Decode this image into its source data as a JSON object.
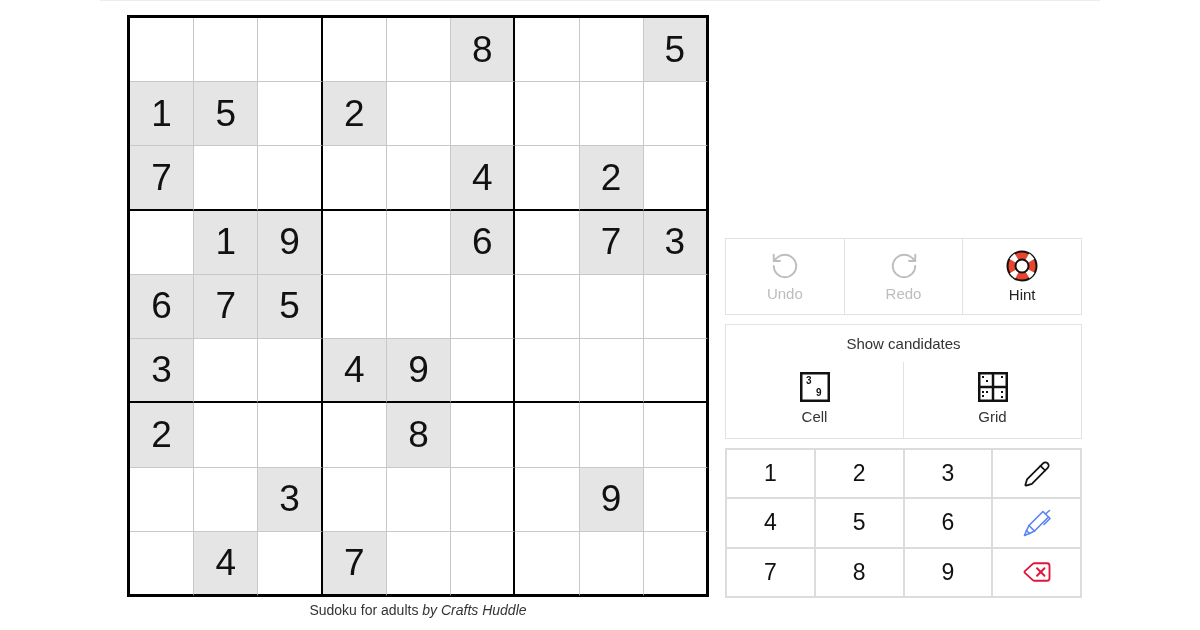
{
  "puzzle": {
    "rows": [
      [
        {
          "given": false
        },
        {
          "given": false
        },
        {
          "given": false
        },
        {
          "given": false
        },
        {
          "given": false
        },
        {
          "given": true,
          "value": "8"
        },
        {
          "given": false
        },
        {
          "given": false
        },
        {
          "given": true,
          "value": "5"
        }
      ],
      [
        {
          "given": true,
          "value": "1"
        },
        {
          "given": true,
          "value": "5"
        },
        {
          "given": false
        },
        {
          "given": true,
          "value": "2"
        },
        {
          "given": false
        },
        {
          "given": false
        },
        {
          "given": false
        },
        {
          "given": false
        },
        {
          "given": false
        }
      ],
      [
        {
          "given": true,
          "value": "7"
        },
        {
          "given": false
        },
        {
          "given": false
        },
        {
          "given": false
        },
        {
          "given": false
        },
        {
          "given": true,
          "value": "4"
        },
        {
          "given": false
        },
        {
          "given": true,
          "value": "2"
        },
        {
          "given": false
        }
      ],
      [
        {
          "given": false
        },
        {
          "given": true,
          "value": "1"
        },
        {
          "given": true,
          "value": "9"
        },
        {
          "given": false
        },
        {
          "given": false
        },
        {
          "given": true,
          "value": "6"
        },
        {
          "given": false
        },
        {
          "given": true,
          "value": "7"
        },
        {
          "given": true,
          "value": "3"
        }
      ],
      [
        {
          "given": true,
          "value": "6"
        },
        {
          "given": true,
          "value": "7"
        },
        {
          "given": true,
          "value": "5"
        },
        {
          "given": false
        },
        {
          "given": false
        },
        {
          "given": false
        },
        {
          "given": false
        },
        {
          "given": false
        },
        {
          "given": false
        }
      ],
      [
        {
          "given": true,
          "value": "3"
        },
        {
          "given": false
        },
        {
          "given": false
        },
        {
          "given": true,
          "value": "4"
        },
        {
          "given": true,
          "value": "9"
        },
        {
          "given": false
        },
        {
          "given": false
        },
        {
          "given": false
        },
        {
          "given": false
        }
      ],
      [
        {
          "given": true,
          "value": "2"
        },
        {
          "given": false
        },
        {
          "given": false
        },
        {
          "given": false
        },
        {
          "given": true,
          "value": "8"
        },
        {
          "given": false
        },
        {
          "given": false
        },
        {
          "given": false
        },
        {
          "given": false
        }
      ],
      [
        {
          "given": false
        },
        {
          "given": false
        },
        {
          "given": true,
          "value": "3"
        },
        {
          "given": false
        },
        {
          "given": false
        },
        {
          "given": false
        },
        {
          "given": false
        },
        {
          "given": true,
          "value": "9"
        },
        {
          "given": false
        }
      ],
      [
        {
          "given": false
        },
        {
          "given": true,
          "value": "4"
        },
        {
          "given": false
        },
        {
          "given": true,
          "value": "7"
        },
        {
          "given": false
        },
        {
          "given": false
        },
        {
          "given": false
        },
        {
          "given": false
        },
        {
          "given": false
        }
      ]
    ]
  },
  "caption": "Sudoku for adults *by Crafts Huddle*",
  "history_buttons": [
    {
      "kind": "undo",
      "label": "Undo",
      "disabled": true
    },
    {
      "kind": "redo",
      "label": "Redo",
      "disabled": true
    },
    {
      "kind": "hint",
      "label": "Hint",
      "disabled": false
    }
  ],
  "candidates": {
    "title": "Show candidates",
    "buttons": [
      {
        "kind": "cell",
        "label": "Cell",
        "icon_digits": [
          "3",
          "9"
        ]
      },
      {
        "kind": "grid",
        "label": "Grid"
      }
    ]
  },
  "keypad": [
    {
      "kind": "digit",
      "label": "1"
    },
    {
      "kind": "digit",
      "label": "2"
    },
    {
      "kind": "digit",
      "label": "3"
    },
    {
      "kind": "pencil"
    },
    {
      "kind": "digit",
      "label": "4"
    },
    {
      "kind": "digit",
      "label": "5"
    },
    {
      "kind": "digit",
      "label": "6"
    },
    {
      "kind": "pen"
    },
    {
      "kind": "digit",
      "label": "7"
    },
    {
      "kind": "digit",
      "label": "8"
    },
    {
      "kind": "digit",
      "label": "9"
    },
    {
      "kind": "erase"
    }
  ]
}
